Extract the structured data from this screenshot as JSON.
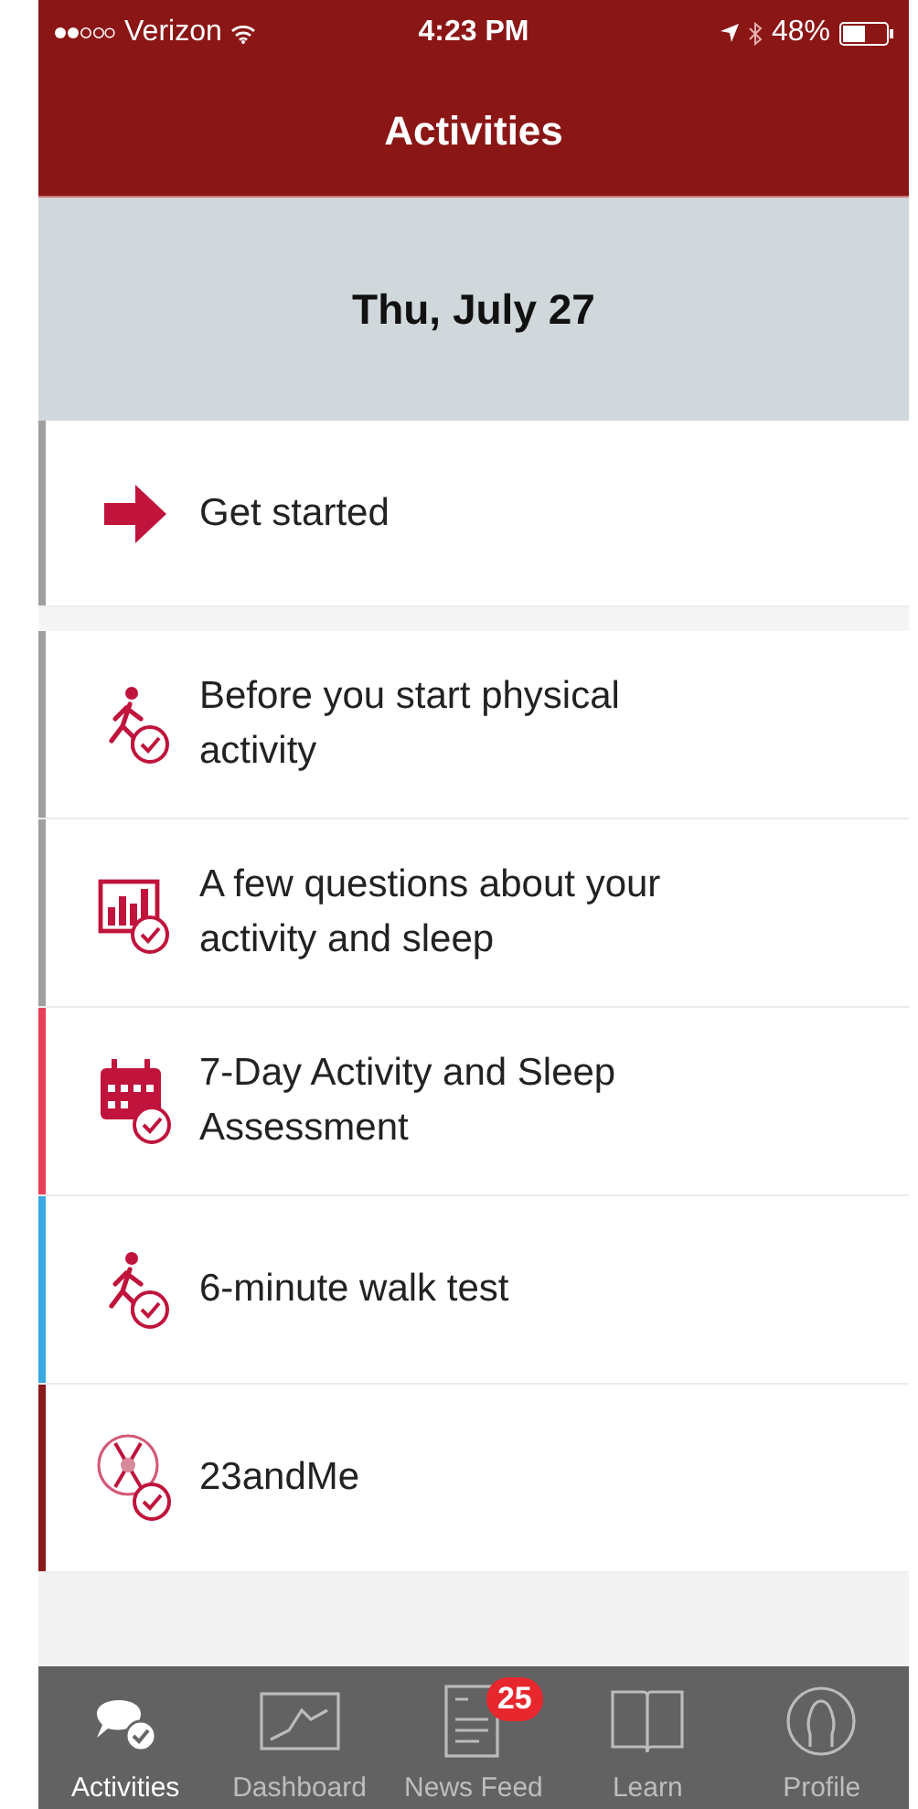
{
  "status_bar": {
    "carrier": "Verizon",
    "time": "4:23 PM",
    "battery": "48%"
  },
  "nav_bar": {
    "title": "Activities"
  },
  "date_header": "Thu, July 27",
  "activities": [
    {
      "kind": "arrow",
      "title": "Get started",
      "color": "#a0a0a0"
    },
    {
      "kind": "walker",
      "title": "Before you start physical activity",
      "color": "#a0a0a0"
    },
    {
      "kind": "chart",
      "title": "A few questions about your activity and sleep",
      "color": "#a0a0a0"
    },
    {
      "kind": "calendar",
      "title": "7-Day Activity and Sleep Assessment",
      "color": "#e8405a"
    },
    {
      "kind": "walker",
      "title": "6-minute walk test",
      "color": "#3aa8e0"
    },
    {
      "kind": "dna",
      "title": "23andMe",
      "color": "#8b1a1a"
    }
  ],
  "tab_bar": [
    {
      "kind": "activities",
      "label": "Activities",
      "selected": true
    },
    {
      "kind": "dashboard",
      "label": "Dashboard",
      "selected": false
    },
    {
      "kind": "news",
      "label": "News Feed",
      "selected": false,
      "badge": "25"
    },
    {
      "kind": "learn",
      "label": "Learn",
      "selected": false
    },
    {
      "kind": "profile",
      "label": "Profile",
      "selected": false
    }
  ]
}
